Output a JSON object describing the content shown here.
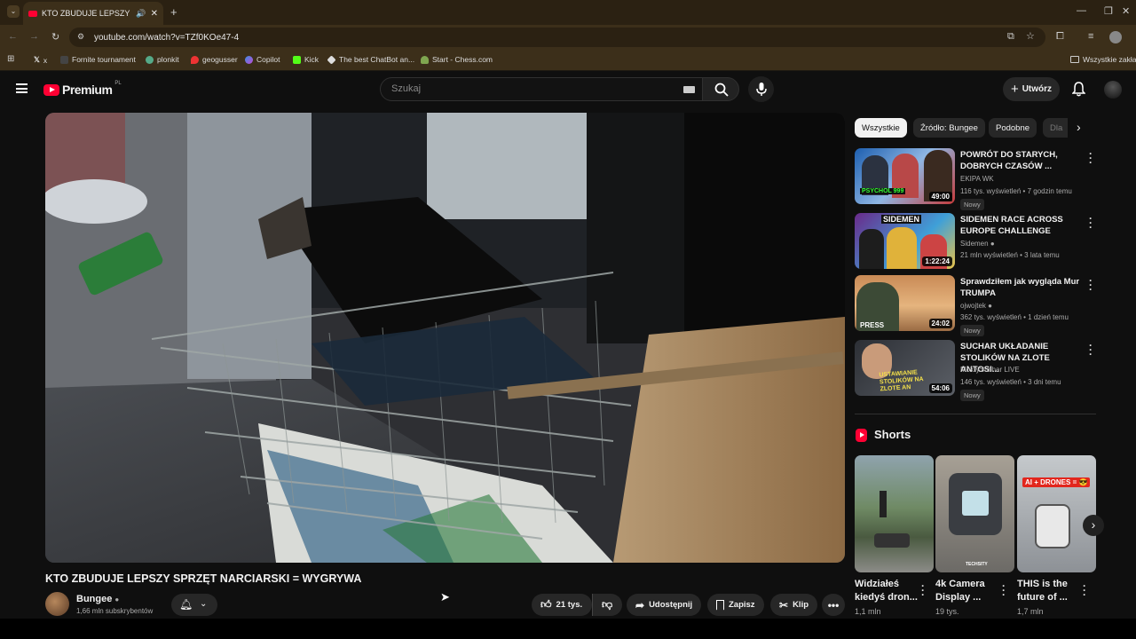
{
  "browser": {
    "tab_title": "KTO ZBUDUJE LEPSZY SPRZ",
    "url": "youtube.com/watch?v=TZf0KOe47-4",
    "bookmarks": [
      "x",
      "Fornite tournament",
      "plonkit",
      "geogusser",
      "Copilot",
      "Kick",
      "The best ChatBot an...",
      "Start - Chess.com"
    ],
    "all_bookmarks": "Wszystkie zakład"
  },
  "header": {
    "logo": "Premium",
    "logo_region": "PL",
    "search_placeholder": "Szukaj",
    "create_label": "Utwórz"
  },
  "video": {
    "title": "KTO ZBUDUJE LEPSZY SPRZĘT NARCIARSKI = WYGRYWA",
    "channel": "Bungee",
    "subscribers": "1,66 mln subskrybentów",
    "likes": "21 tys.",
    "share": "Udostępnij",
    "save": "Zapisz",
    "clip": "Klip"
  },
  "chips": [
    "Wszystkie",
    "Źródło: Bungee",
    "Podobne",
    "Dla"
  ],
  "related": [
    {
      "title": "POWRÓT DO STARYCH, DOBRYCH CZASÓW ...",
      "channel": "EKIPA WK",
      "meta": "116 tys. wyświetleń • 7 godzin temu",
      "badge": "Nowy",
      "duration": "49:00",
      "thumb_text": "PSYCHOL 999"
    },
    {
      "title": "SIDEMEN RACE ACROSS EUROPE CHALLENGE",
      "channel": "Sidemen",
      "meta": "21 mln wyświetleń • 3 lata temu",
      "badge": "",
      "duration": "1:22:24",
      "thumb_text": "SIDEMEN"
    },
    {
      "title": "Sprawdziłem jak wygląda Mur TRUMPA",
      "channel": "ojwojtek",
      "meta": "362 tys. wyświetleń • 1 dzień temu",
      "badge": "Nowy",
      "duration": "24:02",
      "thumb_text": "PRESS"
    },
    {
      "title": "SUCHAR UKŁADANIE STOLIKÓW NA ZLOTE ANTOSI...",
      "channel": "MokrySuchar LIVE",
      "meta": "146 tys. wyświetleń • 3 dni temu",
      "badge": "Nowy",
      "duration": "54:06",
      "thumb_text": "USTAWIANIE STOLIKÓW NA ZLOTE AN"
    }
  ],
  "shorts": {
    "heading": "Shorts",
    "items": [
      {
        "title": "Widziałeś kiedyś dron...",
        "views": "1,1 mln",
        "thumb_text": ""
      },
      {
        "title": "4k Camera Display ...",
        "views": "19 tys.",
        "thumb_text": "TECHSITY"
      },
      {
        "title": "THIS is the future of ...",
        "views": "1,7 mln",
        "thumb_text": "AI + DRONES = 😎"
      }
    ]
  },
  "colors": {
    "background": "#0f0f0f",
    "chip_active": "#f1f1f1",
    "youtube_red": "#ff0033"
  }
}
